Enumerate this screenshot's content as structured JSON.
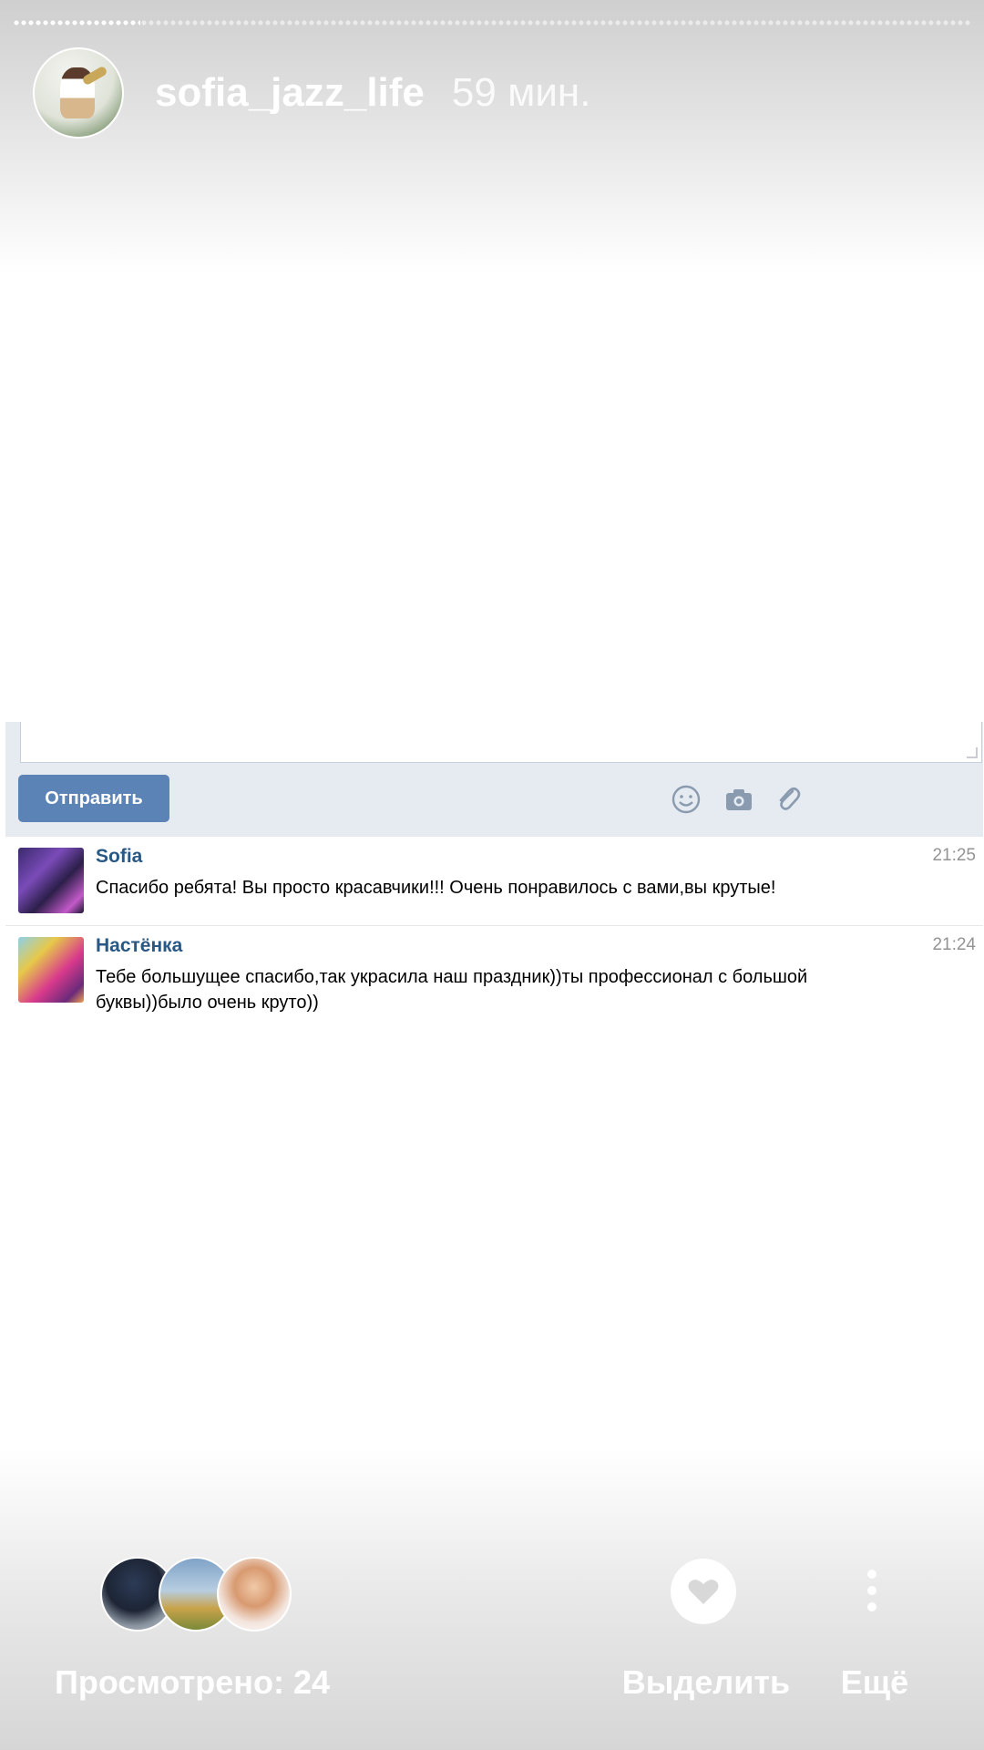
{
  "story": {
    "username": "sofia_jazz_life",
    "time_ago": "59 мин."
  },
  "vk": {
    "send_label": "Отправить",
    "icons": [
      "smile-icon",
      "camera-icon",
      "paperclip-icon"
    ],
    "messages": [
      {
        "author": "Sofia",
        "time": "21:25",
        "text": "Спасибо ребята! Вы просто красавчики!!! Очень понравилось с вами,вы крутые!"
      },
      {
        "author": "Настёнка",
        "time": "21:24",
        "text": "Тебе большущее спасибо,так украсила наш праздник))ты профессионал с большой буквы))было очень круто))"
      }
    ]
  },
  "footer": {
    "views_label": "Просмотрено: 24",
    "highlight_label": "Выделить",
    "more_label": "Ещё"
  },
  "colors": {
    "vk_link": "#2a5885",
    "vk_button": "#5b83b5",
    "vk_panel": "#e6ebf1"
  }
}
